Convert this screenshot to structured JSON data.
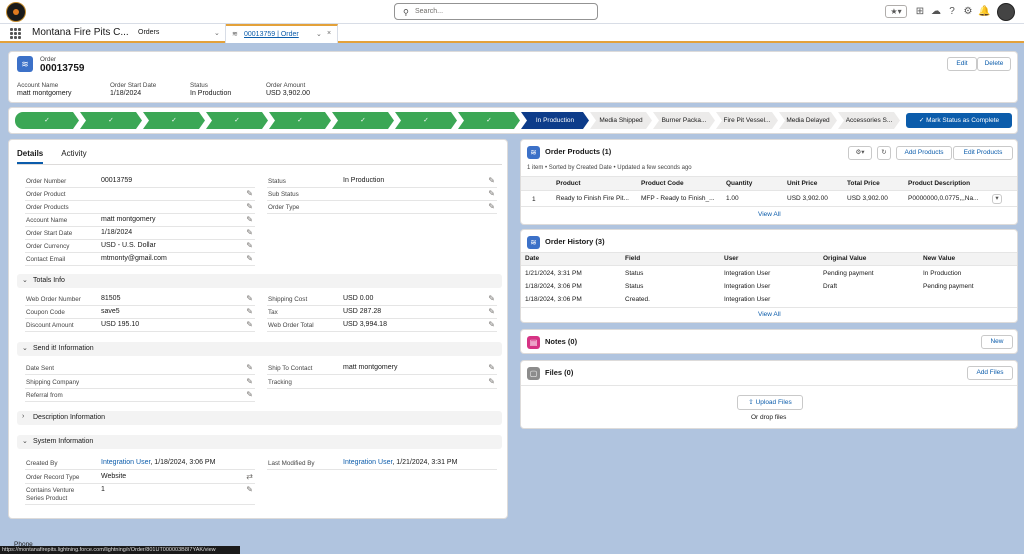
{
  "header": {
    "search_placeholder": "Search...",
    "icons": [
      "star-icon",
      "plus-icon",
      "cloud-icon",
      "help-icon",
      "gear-icon",
      "bell-icon"
    ]
  },
  "nav": {
    "app_name": "Montana Fire Pits C...",
    "tabs": [
      {
        "label": "Orders"
      },
      {
        "label": "00013759 | Order"
      }
    ]
  },
  "record": {
    "object": "Order",
    "number": "00013759",
    "edit_label": "Edit",
    "delete_label": "Delete",
    "highlights": [
      {
        "label": "Account Name",
        "value": "matt montgomery"
      },
      {
        "label": "Order Start Date",
        "value": "1/18/2024"
      },
      {
        "label": "Status",
        "value": "In Production"
      },
      {
        "label": "Order Amount",
        "value": "USD 3,902.00"
      }
    ]
  },
  "path": {
    "done_count": 8,
    "steps": [
      "In Production",
      "Media Shipped",
      "Burner Packa...",
      "Fire Pit Vessel...",
      "Media Delayed",
      "Accessories S..."
    ],
    "mark_label": "Mark Status as Complete"
  },
  "details": {
    "tabs": [
      "Details",
      "Activity"
    ],
    "left": [
      {
        "label": "Order Number",
        "value": "00013759"
      },
      {
        "label": "Order Product",
        "value": ""
      },
      {
        "label": "Order Products",
        "value": ""
      },
      {
        "label": "Account Name",
        "value": "matt montgomery"
      },
      {
        "label": "Order Start Date",
        "value": "1/18/2024"
      },
      {
        "label": "Order Currency",
        "value": "USD - U.S. Dollar"
      },
      {
        "label": "Contact Email",
        "value": "mtmonty@gmail.com"
      }
    ],
    "right": [
      {
        "label": "Status",
        "value": "In Production"
      },
      {
        "label": "Sub Status",
        "value": ""
      },
      {
        "label": "Order Type",
        "value": ""
      }
    ],
    "totals_title": "Totals Info",
    "totals_left": [
      {
        "label": "Web Order Number",
        "value": "81505"
      },
      {
        "label": "Coupon Code",
        "value": "save5"
      },
      {
        "label": "Discount Amount",
        "value": "USD 195.10"
      }
    ],
    "totals_right": [
      {
        "label": "Shipping Cost",
        "value": "USD 0.00"
      },
      {
        "label": "Tax",
        "value": "USD 287.28"
      },
      {
        "label": "Web Order Total",
        "value": "USD 3,994.18"
      }
    ],
    "send_title": "Send it! Information",
    "send_left": [
      {
        "label": "Date Sent",
        "value": ""
      },
      {
        "label": "Shipping Company",
        "value": ""
      },
      {
        "label": "Referral from",
        "value": ""
      }
    ],
    "send_right": [
      {
        "label": "Ship To Contact",
        "value": "matt montgomery"
      },
      {
        "label": "Tracking",
        "value": ""
      }
    ],
    "desc_title": "Description Information",
    "system_title": "System Information",
    "created_by_label": "Created By",
    "created_by_user": "Integration User",
    "created_by_date": ", 1/18/2024, 3:06 PM",
    "modified_label": "Last Modified By",
    "modified_user": "Integration User",
    "modified_date": ", 1/21/2024, 3:31 PM",
    "record_type_label": "Order Record Type",
    "record_type_value": "Website",
    "venture_label": "Contains Venture Series Product",
    "venture_value": "1"
  },
  "order_products": {
    "title": "Order Products (1)",
    "subtitle": "1 item • Sorted by Created Date • Updated a few seconds ago",
    "add_label": "Add Products",
    "edit_label": "Edit Products",
    "columns": [
      "Product",
      "Product Code",
      "Quantity",
      "Unit Price",
      "Total Price",
      "Product Description"
    ],
    "rows": [
      {
        "num": "1",
        "product": "Ready to Finish Fire Pit...",
        "code": "MFP - Ready to Finish_...",
        "qty": "1.00",
        "unit": "USD 3,902.00",
        "total": "USD 3,902.00",
        "desc": "P0000000,0.0775,,,Na..."
      }
    ],
    "view_all": "View All"
  },
  "order_history": {
    "title": "Order History (3)",
    "columns": [
      "Date",
      "Field",
      "User",
      "Original Value",
      "New Value"
    ],
    "rows": [
      {
        "date": "1/21/2024, 3:31 PM",
        "field": "Status",
        "user": "Integration User",
        "orig": "Pending payment",
        "new": "In Production"
      },
      {
        "date": "1/18/2024, 3:06 PM",
        "field": "Status",
        "user": "Integration User",
        "orig": "Draft",
        "new": "Pending payment"
      },
      {
        "date": "1/18/2024, 3:06 PM",
        "field": "Created.",
        "user": "Integration User",
        "orig": "",
        "new": ""
      }
    ],
    "view_all": "View All"
  },
  "notes": {
    "title": "Notes (0)",
    "new_label": "New"
  },
  "files": {
    "title": "Files (0)",
    "add_label": "Add Files",
    "upload_label": "Upload Files",
    "drop_label": "Or drop files"
  },
  "footer": {
    "url": "https://montanafirepits.lightning.force.com/lightning/r/Order/801UT000003B8I7YAK/view",
    "phone": "Phone"
  }
}
